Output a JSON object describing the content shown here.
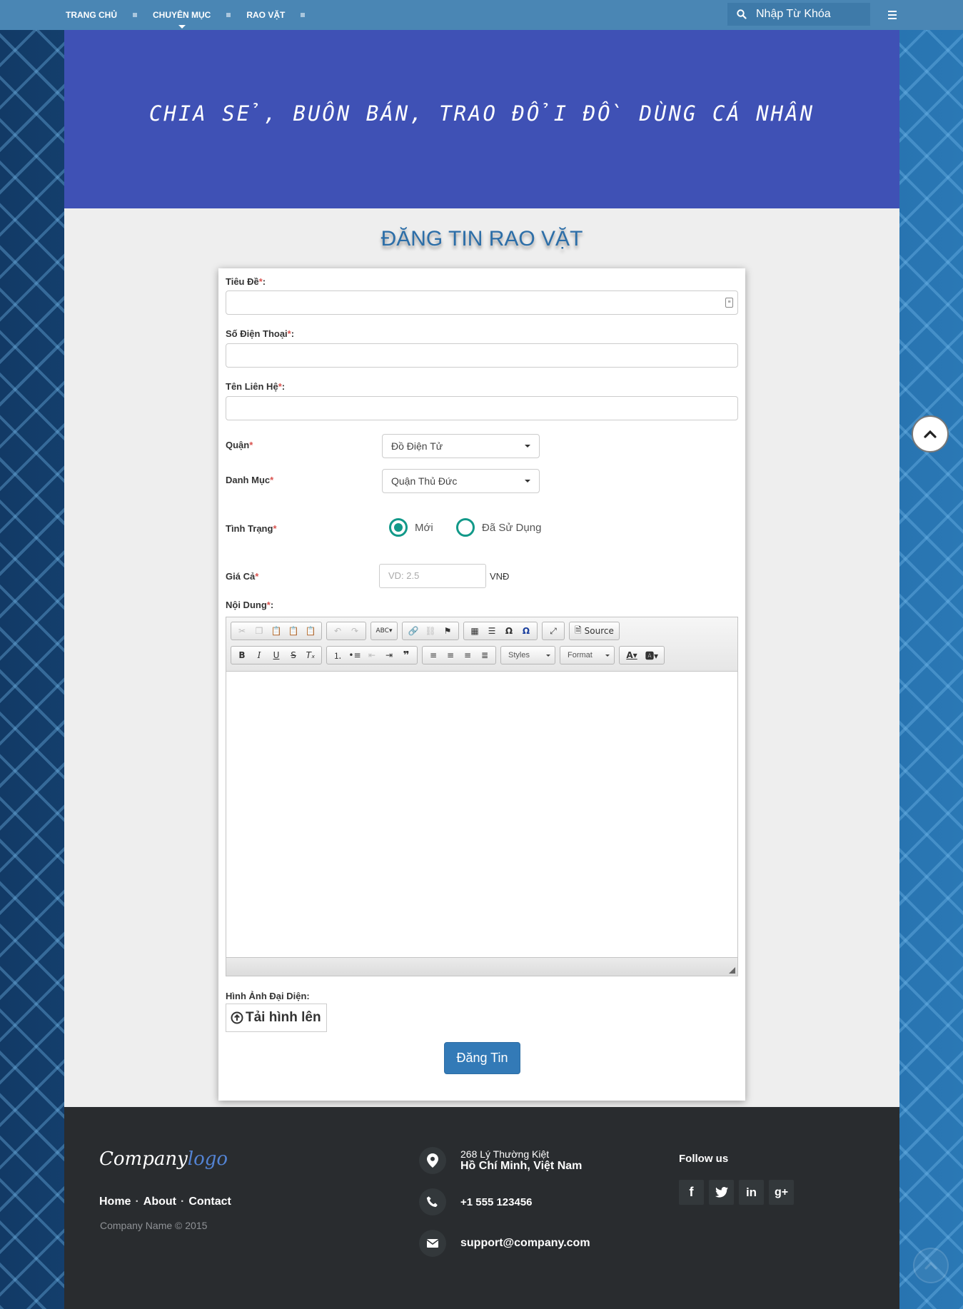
{
  "nav": {
    "items": [
      {
        "label": "TRANG CHỦ"
      },
      {
        "label": "CHUYÊN MỤC"
      },
      {
        "label": "RAO VẶT"
      }
    ],
    "search_placeholder": "Nhập Từ Khóa"
  },
  "banner": {
    "title": "CHIA SẺ, BUÔN BÁN, TRAO ĐỔI ĐỒ DÙNG CÁ NHÂN"
  },
  "page": {
    "title": "ĐĂNG TIN RAO VẶT"
  },
  "form": {
    "title_label": "Tiêu Đề",
    "phone_label": "Số Điện Thoại",
    "contact_label": "Tên Liên Hệ",
    "district_label": "Quận",
    "district_value": "Đồ Điện Tử",
    "category_label": "Danh Mục",
    "category_value": "Quận Thủ Đức",
    "condition_label": "Tình Trạng",
    "condition_options": [
      {
        "label": "Mới",
        "checked": true
      },
      {
        "label": "Đã Sử Dụng",
        "checked": false
      }
    ],
    "price_label": "Giá Cả",
    "price_placeholder": "VD: 2.5",
    "price_unit": "VNĐ",
    "content_label": "Nội Dung",
    "required_mark": "*",
    "colon": ":",
    "image_label": "Hình Ảnh Đại Diện:",
    "upload_label": "Tải hình lên",
    "submit_label": "Đăng Tin"
  },
  "editor": {
    "source_label": "Source",
    "styles_label": "Styles",
    "format_label": "Format"
  },
  "footer": {
    "logo_main": "Company",
    "logo_accent": "logo",
    "links": [
      "Home",
      "About",
      "Contact"
    ],
    "link_separator": "·",
    "copyright": "Company Name © 2015",
    "address_line1": "268 Lý Thường Kiệt",
    "address_line2": "Hồ Chí Minh, Việt Nam",
    "phone": "+1 555 123456",
    "email": "support@company.com",
    "follow_label": "Follow us",
    "social": [
      "facebook-icon",
      "twitter-icon",
      "linkedin-icon",
      "google-plus-icon"
    ]
  },
  "colors": {
    "navbar": "#4a86b4",
    "banner": "#3f51b5",
    "radio_accent": "#129989",
    "submit": "#337ab7",
    "footer": "#292c2f",
    "required": "#d9534f"
  }
}
